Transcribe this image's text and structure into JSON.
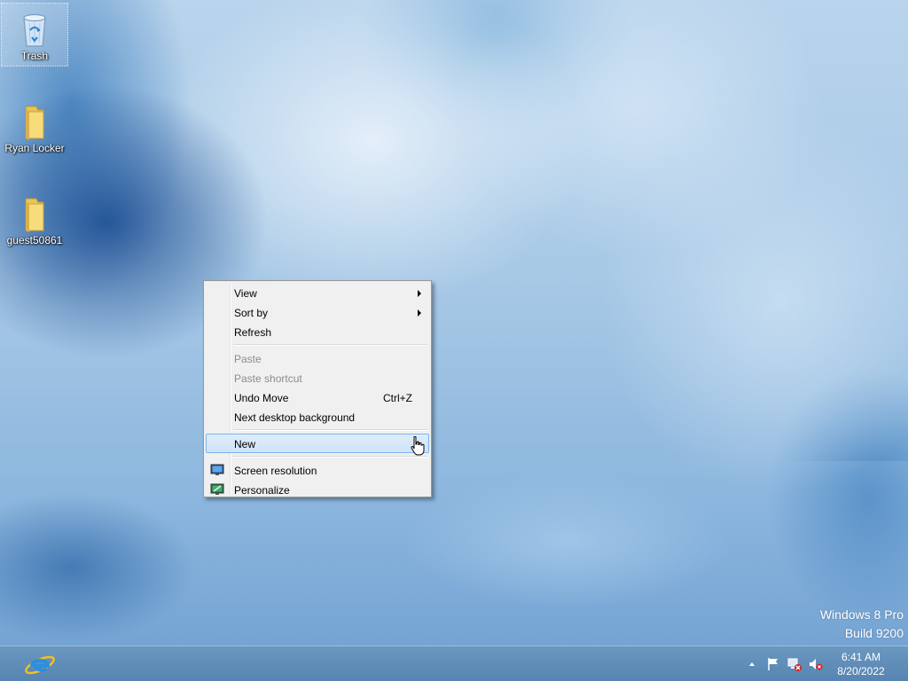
{
  "desktop": {
    "icons": [
      {
        "label": "Trash",
        "icon": "recycle-bin-icon",
        "selected": true
      },
      {
        "label": "Ryan Locker",
        "icon": "folder-icon"
      },
      {
        "label": "guest50861",
        "icon": "folder-icon"
      }
    ]
  },
  "context_menu": {
    "items": [
      {
        "label": "View",
        "submenu": true
      },
      {
        "label": "Sort by",
        "submenu": true
      },
      {
        "label": "Refresh"
      },
      {
        "label": "Paste",
        "disabled": true
      },
      {
        "label": "Paste shortcut",
        "disabled": true
      },
      {
        "label": "Undo Move",
        "shortcut": "Ctrl+Z"
      },
      {
        "label": "Next desktop background"
      },
      {
        "label": "New",
        "submenu": true,
        "highlighted": true
      },
      {
        "label": "Screen resolution",
        "icon": "screen-resolution-icon"
      },
      {
        "label": "Personalize",
        "icon": "personalize-icon"
      }
    ]
  },
  "watermark": {
    "line1": "Windows 8 Pro",
    "line2": "Build 9200"
  },
  "taskbar": {
    "pinned": [
      {
        "name": "Internet Explorer",
        "icon": "internet-explorer-icon"
      }
    ],
    "tray_icons": [
      "show-hidden-icons-chevron-icon",
      "action-center-flag-icon",
      "network-disconnected-icon",
      "volume-muted-icon"
    ],
    "clock": {
      "time": "6:41 AM",
      "date": "8/20/2022"
    }
  },
  "colors": {
    "menu_highlight": "#cfe3f8",
    "menu_highlight_border": "#7eb4ea",
    "taskbar": "#5f8db8"
  }
}
